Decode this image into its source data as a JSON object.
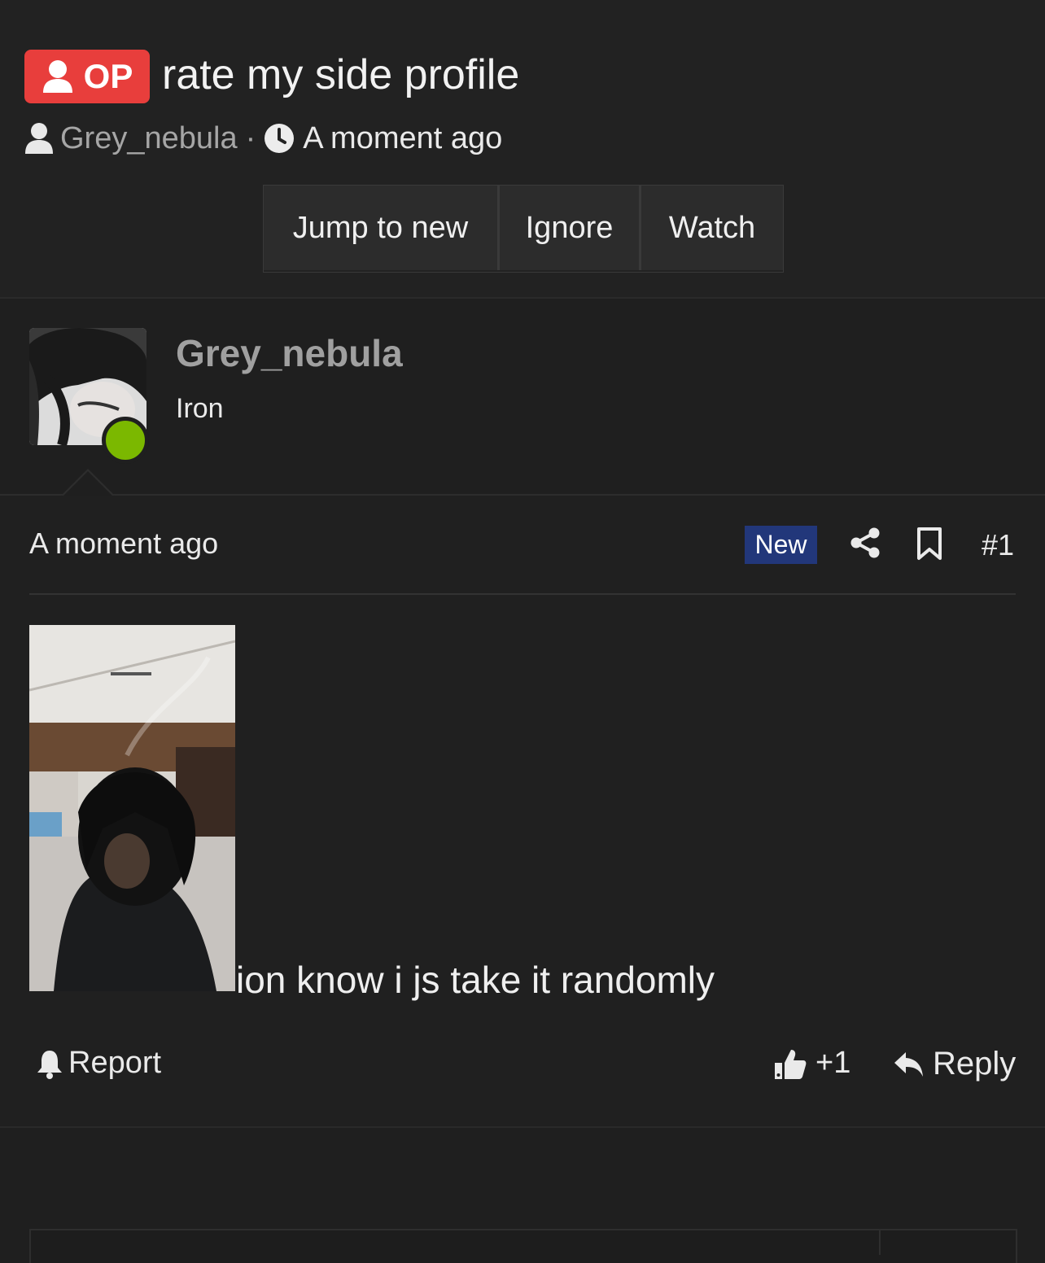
{
  "thread": {
    "op_label": "OP",
    "title": "rate my side profile",
    "author": "Grey_nebula",
    "separator": "·",
    "time": "A moment ago"
  },
  "actions": {
    "jump_to_new": "Jump to new",
    "ignore": "Ignore",
    "watch": "Watch"
  },
  "user": {
    "name": "Grey_nebula",
    "rank": "Iron",
    "online_color": "#7bb800"
  },
  "post": {
    "time": "A moment ago",
    "new_label": "New",
    "number": "#1",
    "text": "ion know i js take it randomly",
    "report_label": "Report",
    "like_count": "+1",
    "reply_label": "Reply"
  },
  "colors": {
    "op_badge": "#e83e3c",
    "new_badge": "#22377a",
    "background": "#1f1f1f"
  },
  "icons": [
    "user-icon",
    "clock-icon",
    "share-icon",
    "bookmark-icon",
    "bell-icon",
    "thumbs-up-icon",
    "reply-icon"
  ]
}
